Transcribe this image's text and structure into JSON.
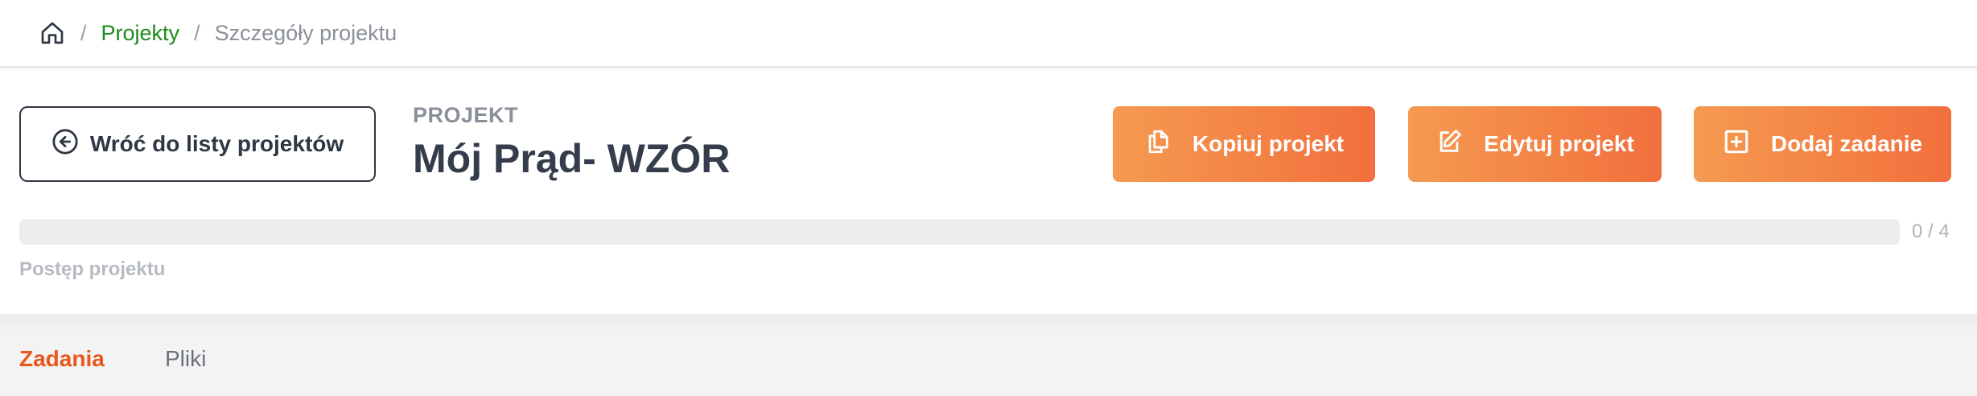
{
  "breadcrumb": {
    "home_icon": "home-icon",
    "separator": "/",
    "projects_label": "Projekty",
    "current_label": "Szczegóły projektu"
  },
  "header": {
    "back_button_label": "Wróć do listy projektów",
    "back_icon": "arrow-left-circle-icon",
    "kicker": "PROJEKT",
    "title": "Mój Prąd- WZÓR"
  },
  "actions": [
    {
      "label": "Kopiuj projekt",
      "icon": "copy-icon"
    },
    {
      "label": "Edytuj projekt",
      "icon": "edit-icon"
    },
    {
      "label": "Dodaj zadanie",
      "icon": "plus-square-icon"
    }
  ],
  "progress": {
    "completed": 0,
    "total": 4,
    "count_text": "0 / 4",
    "label": "Postęp projektu"
  },
  "tabs": [
    {
      "label": "Zadania",
      "active": true
    },
    {
      "label": "Pliki",
      "active": false
    }
  ],
  "colors": {
    "accent_start": "#f59a50",
    "accent_end": "#f26f3d",
    "active_tab": "#e8581c",
    "link_green": "#1d8a1d",
    "title_text": "#353c4b"
  }
}
